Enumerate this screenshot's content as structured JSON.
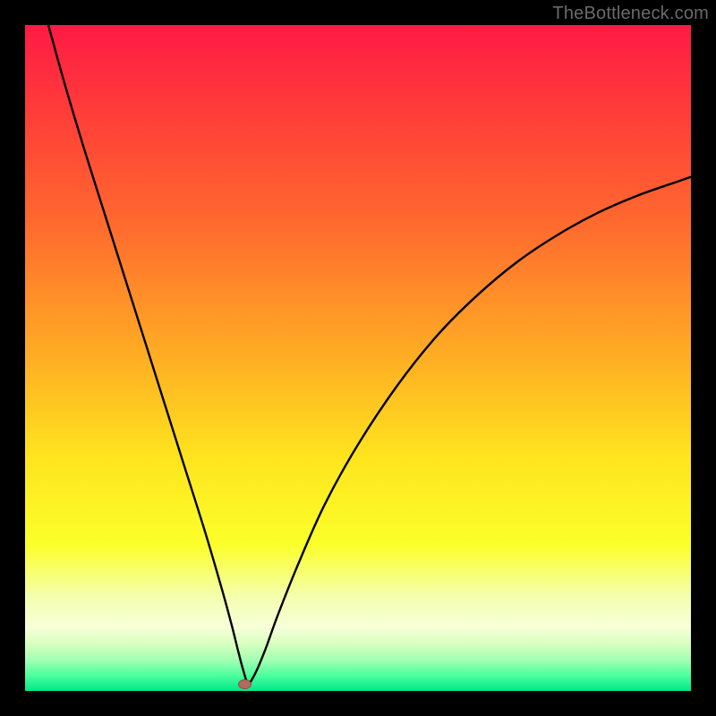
{
  "watermark": "TheBottleneck.com",
  "colors": {
    "frame": "#000000",
    "curve": "#000000",
    "marker_fill": "#b66a5e",
    "marker_stroke": "#8e4d43",
    "gradient_stops": [
      {
        "offset": 0.0,
        "color": "#ff1a44"
      },
      {
        "offset": 0.12,
        "color": "#ff3a3a"
      },
      {
        "offset": 0.3,
        "color": "#ff6a2e"
      },
      {
        "offset": 0.5,
        "color": "#ffae23"
      },
      {
        "offset": 0.65,
        "color": "#ffe41e"
      },
      {
        "offset": 0.78,
        "color": "#fbff2a"
      },
      {
        "offset": 0.86,
        "color": "#f4ffb0"
      },
      {
        "offset": 0.905,
        "color": "#f7ffd8"
      },
      {
        "offset": 0.93,
        "color": "#d6ffbf"
      },
      {
        "offset": 0.955,
        "color": "#9effb1"
      },
      {
        "offset": 0.975,
        "color": "#52ff9e"
      },
      {
        "offset": 1.0,
        "color": "#00e88a"
      }
    ]
  },
  "chart_data": {
    "type": "line",
    "title": "",
    "xlabel": "",
    "ylabel": "",
    "xlim": [
      0,
      100
    ],
    "ylim": [
      0,
      100
    ],
    "legend": false,
    "grid": false,
    "annotations": [],
    "marker": {
      "x": 33.0,
      "y": 1.0
    },
    "series": [
      {
        "name": "curve",
        "x": [
          3.5,
          6,
          9,
          12,
          15,
          18,
          21,
          24,
          27,
          29.5,
          31,
          32,
          32.8,
          33.5,
          34.5,
          36,
          38,
          41,
          45,
          50,
          56,
          62,
          68,
          74,
          80,
          86,
          92,
          98,
          100
        ],
        "y": [
          100,
          91,
          81,
          71.5,
          62,
          52.5,
          43,
          33.5,
          24,
          15.5,
          10,
          6,
          3,
          1.2,
          2.5,
          6,
          11.5,
          19,
          28,
          37,
          46,
          53.5,
          59.5,
          64.5,
          68.5,
          71.8,
          74.4,
          76.5,
          77.2
        ]
      }
    ]
  }
}
